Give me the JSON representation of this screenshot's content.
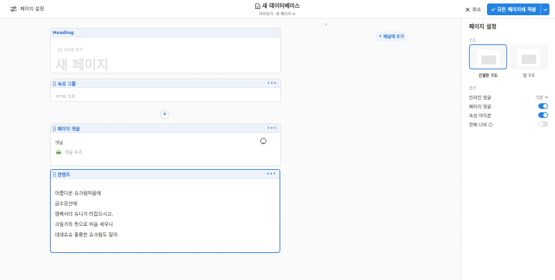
{
  "topbar": {
    "page_settings_label": "페이지 설정",
    "title": "새 데이터베이스",
    "preview_label": "미리보기: 새 페이지",
    "cancel_label": "취소",
    "apply_label": "모든 페이지에 적용"
  },
  "canvas": {
    "heading_label": "Heading",
    "icon_add_label": "아이콘 추가",
    "page_title_placeholder": "새 페이지",
    "property_group_label": "속성 그룹",
    "html_placeholder": "HTML 입음",
    "comments_label": "페이지 댓글",
    "comments_heading": "댓글",
    "add_comment_label": "댓글 추가",
    "content_label": "콘텐츠",
    "content_lines": [
      "아름다운 슈크림마을에",
      "금수강산에",
      "엠베서더 슈니가 터잡으시고,",
      "크림가득 뜻으로 마을 세우니",
      "대대슈슈 훌륭한 슈크림도 많아"
    ],
    "panel_add_label": "패널에 추가"
  },
  "sidebar": {
    "title": "페이지 설정",
    "structure_label": "구조",
    "layout_options": [
      {
        "label": "간결한 구조",
        "selected": true
      },
      {
        "label": "탭 구조",
        "selected": false
      }
    ],
    "options_label": "옵션",
    "rows": [
      {
        "label": "인라인 댓글",
        "value": "기본",
        "type": "select"
      },
      {
        "label": "페이지 댓글",
        "on": true,
        "type": "toggle"
      },
      {
        "label": "속성 아이콘",
        "on": true,
        "type": "toggle"
      },
      {
        "label": "전체 너비",
        "on": false,
        "type": "toggle"
      }
    ]
  },
  "colors": {
    "accent": "#2383e2",
    "card_header_bg": "#eef3fb",
    "card_header_text": "#2f6fcf"
  }
}
